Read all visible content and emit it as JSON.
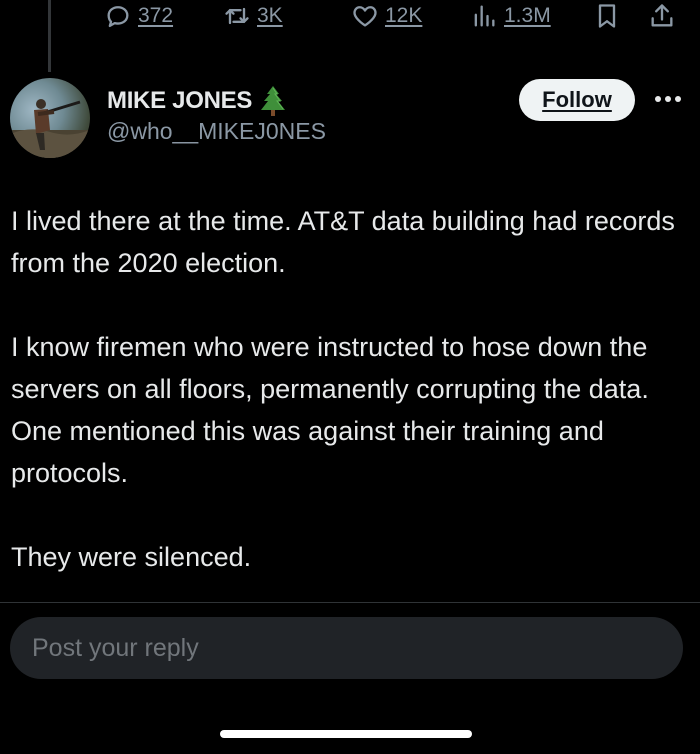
{
  "actions": {
    "reply_count": "372",
    "repost_count": "3K",
    "like_count": "12K",
    "view_count": "1.3M"
  },
  "author": {
    "display_name": "MIKE JONES",
    "emoji": "christmas-tree-icon",
    "handle": "@who__MIKEJ0NES"
  },
  "follow_button": {
    "label": "Follow"
  },
  "tweet": {
    "paragraphs": [
      "I lived there at the time. AT&T data building had records from the 2020 election.",
      "I know firemen who were instructed to hose down the servers on all floors, permanently corrupting the data. One mentioned this was against their training and protocols.",
      "They were silenced."
    ]
  },
  "reply": {
    "placeholder": "Post your reply"
  },
  "colors": {
    "background": "#000000",
    "text_primary": "#e7e9ea",
    "text_secondary": "#8b98a5",
    "follow_bg": "#eff3f4",
    "input_bg": "#202327"
  }
}
